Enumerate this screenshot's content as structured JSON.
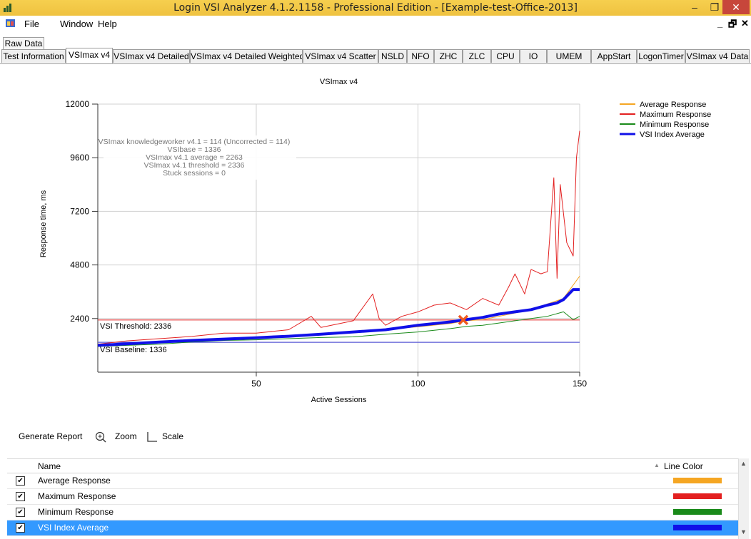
{
  "window": {
    "title": "Login VSI Analyzer 4.1.2.1158 - Professional Edition - [Example-test-Office-2013]",
    "controls": {
      "minimize": "–",
      "maximize": "❐",
      "close": "✕"
    }
  },
  "menu": {
    "items": [
      "File",
      "Window",
      "Help"
    ],
    "mdi_controls": [
      "_",
      "🗗",
      "✕"
    ]
  },
  "raw_tab": "Raw Data",
  "tabs": [
    "Test Information",
    "VSImax v4",
    "VSImax v4 Detailed",
    "VSImax v4 Detailed Weighted",
    "VSImax v4 Scatter",
    "NSLD",
    "NFO",
    "ZHC",
    "ZLC",
    "CPU",
    "IO",
    "UMEM",
    "AppStart",
    "LogonTimer",
    "VSImax v4 Data"
  ],
  "active_tab": "VSImax v4",
  "chart_data": {
    "type": "line",
    "title": "VSImax v4",
    "xlabel": "Active Sessions",
    "ylabel": "Response time, ms",
    "xlim": [
      1,
      150
    ],
    "ylim": [
      0,
      12000
    ],
    "x_ticks": [
      50,
      100,
      150
    ],
    "y_ticks": [
      2400,
      4800,
      7200,
      9600,
      12000
    ],
    "grid": true,
    "legend_position": "top-right",
    "annotations": [
      "VSImax knowledgeworker v4.1 = 114 (Uncorrected = 114)",
      "VSIbase = 1336",
      "VSImax v4.1 average = 2263",
      "VSImax v4.1 threshold = 2336",
      "Stuck sessions = 0"
    ],
    "reference_lines": [
      {
        "label": "VSI Threshold: 2336",
        "value": 2336,
        "color": "#e83a3a"
      },
      {
        "label": "VSI Baseline: 1336",
        "value": 1336,
        "color": "#5a5ad6"
      }
    ],
    "vsimax_marker": {
      "x": 114,
      "y": 2336,
      "color": "#f05a1e"
    },
    "series": [
      {
        "name": "Average Response",
        "color": "#f5a623",
        "width": 1,
        "points": [
          [
            1,
            1200
          ],
          [
            10,
            1260
          ],
          [
            20,
            1330
          ],
          [
            30,
            1430
          ],
          [
            40,
            1500
          ],
          [
            50,
            1580
          ],
          [
            60,
            1640
          ],
          [
            70,
            1720
          ],
          [
            80,
            1820
          ],
          [
            90,
            1920
          ],
          [
            100,
            2030
          ],
          [
            110,
            2180
          ],
          [
            115,
            2300
          ],
          [
            120,
            2350
          ],
          [
            125,
            2500
          ],
          [
            130,
            2650
          ],
          [
            135,
            2800
          ],
          [
            140,
            3050
          ],
          [
            145,
            3300
          ],
          [
            150,
            4300
          ]
        ]
      },
      {
        "name": "Maximum Response",
        "color": "#e32020",
        "width": 1,
        "points": [
          [
            1,
            1250
          ],
          [
            10,
            1400
          ],
          [
            20,
            1500
          ],
          [
            30,
            1600
          ],
          [
            40,
            1750
          ],
          [
            50,
            1750
          ],
          [
            60,
            1900
          ],
          [
            67,
            2500
          ],
          [
            70,
            2000
          ],
          [
            80,
            2300
          ],
          [
            86,
            3500
          ],
          [
            88,
            2400
          ],
          [
            90,
            2100
          ],
          [
            95,
            2500
          ],
          [
            100,
            2700
          ],
          [
            105,
            3000
          ],
          [
            110,
            3100
          ],
          [
            115,
            2800
          ],
          [
            120,
            3300
          ],
          [
            125,
            3000
          ],
          [
            128,
            3800
          ],
          [
            130,
            4400
          ],
          [
            133,
            3500
          ],
          [
            135,
            4600
          ],
          [
            138,
            4400
          ],
          [
            140,
            4500
          ],
          [
            142,
            8700
          ],
          [
            143,
            4200
          ],
          [
            144,
            8400
          ],
          [
            146,
            5800
          ],
          [
            148,
            5200
          ],
          [
            149,
            9600
          ],
          [
            150,
            10800
          ]
        ]
      },
      {
        "name": "Minimum Response",
        "color": "#1a8a1a",
        "width": 1,
        "points": [
          [
            1,
            1150
          ],
          [
            10,
            1200
          ],
          [
            20,
            1250
          ],
          [
            30,
            1350
          ],
          [
            40,
            1420
          ],
          [
            50,
            1450
          ],
          [
            60,
            1500
          ],
          [
            70,
            1550
          ],
          [
            80,
            1580
          ],
          [
            90,
            1700
          ],
          [
            100,
            1800
          ],
          [
            110,
            1950
          ],
          [
            115,
            2050
          ],
          [
            120,
            2100
          ],
          [
            125,
            2200
          ],
          [
            130,
            2300
          ],
          [
            135,
            2400
          ],
          [
            140,
            2500
          ],
          [
            145,
            2700
          ],
          [
            148,
            2350
          ],
          [
            150,
            2500
          ]
        ]
      },
      {
        "name": "VSI Index Average",
        "color": "#1010e8",
        "width": 4,
        "points": [
          [
            1,
            1200
          ],
          [
            10,
            1270
          ],
          [
            20,
            1350
          ],
          [
            30,
            1420
          ],
          [
            40,
            1480
          ],
          [
            50,
            1540
          ],
          [
            60,
            1610
          ],
          [
            70,
            1700
          ],
          [
            80,
            1800
          ],
          [
            90,
            1900
          ],
          [
            100,
            2100
          ],
          [
            110,
            2250
          ],
          [
            114,
            2336
          ],
          [
            120,
            2450
          ],
          [
            125,
            2600
          ],
          [
            130,
            2700
          ],
          [
            135,
            2800
          ],
          [
            140,
            3000
          ],
          [
            143,
            3100
          ],
          [
            145,
            3250
          ],
          [
            148,
            3700
          ],
          [
            150,
            3700
          ]
        ]
      }
    ]
  },
  "toolbar": {
    "generate": "Generate Report",
    "zoom": "Zoom",
    "scale": "Scale"
  },
  "list": {
    "headers": {
      "name": "Name",
      "color": "Line Color"
    },
    "rows": [
      {
        "name": "Average Response",
        "color": "#f5a623",
        "checked": "✔"
      },
      {
        "name": "Maximum Response",
        "color": "#e32020",
        "checked": "✔"
      },
      {
        "name": "Minimum Response",
        "color": "#1a8a1a",
        "checked": "✔"
      },
      {
        "name": "VSI Index Average",
        "color": "#1010e8",
        "checked": "✔"
      }
    ]
  }
}
